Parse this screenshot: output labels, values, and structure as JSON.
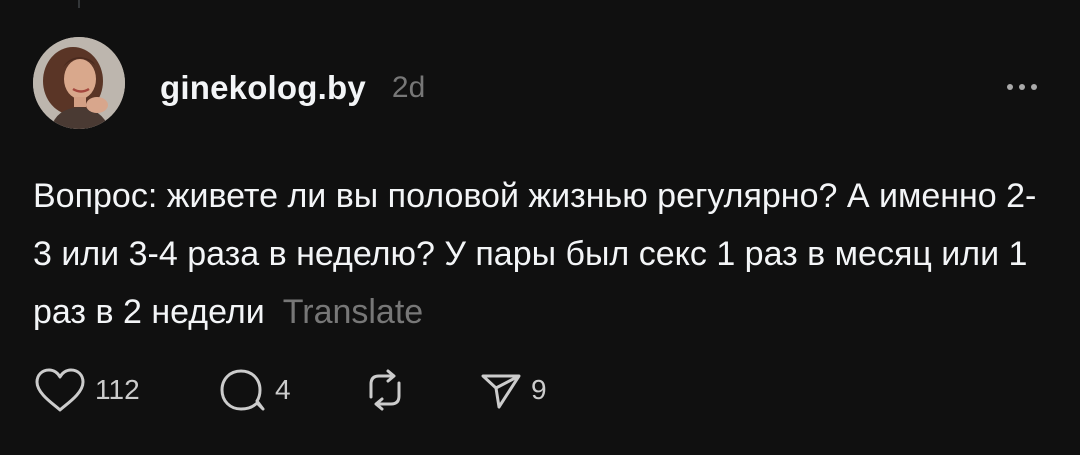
{
  "post": {
    "username": "ginekolog.by",
    "time": "2d",
    "text": "Вопрос: живете ли вы половой жизнью регулярно? А именно 2-3 или 3-4 раза в неделю? У пары был секс 1 раз в месяц или 1 раз в 2 недели",
    "translate_label": "Translate"
  },
  "actions": {
    "likes": "112",
    "replies": "4",
    "shares": "9"
  },
  "colors": {
    "background": "#101010",
    "text_primary": "#f3f5f7",
    "text_secondary": "#777777"
  },
  "icons": [
    "more-icon",
    "heart-icon",
    "comment-icon",
    "repost-icon",
    "share-icon"
  ]
}
